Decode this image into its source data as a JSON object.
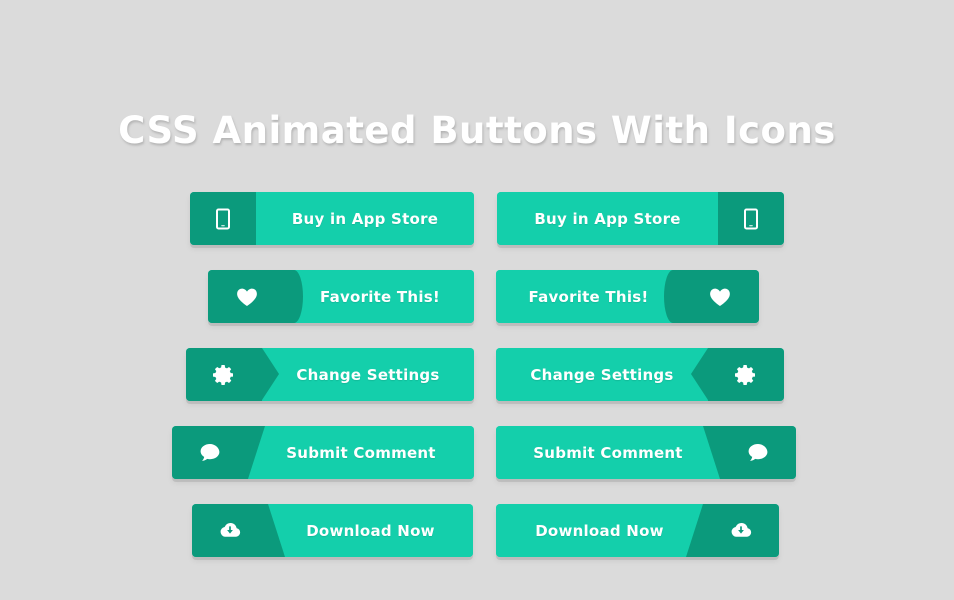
{
  "page": {
    "title": "CSS Animated Buttons With Icons",
    "background_color": "#dbdbdb"
  },
  "colors": {
    "icon_pane": "#0b9a7c",
    "label_pane": "#14cfab",
    "label_text": "#ffffff",
    "title_text": "#ffffff"
  },
  "buttons": [
    {
      "id": "buy-in-app-store-icon-left",
      "label": "Buy in App Store",
      "icon": "tablet-icon",
      "icon_side": "left",
      "divider": "straight"
    },
    {
      "id": "buy-in-app-store-icon-right",
      "label": "Buy in App Store",
      "icon": "tablet-icon",
      "icon_side": "right",
      "divider": "straight"
    },
    {
      "id": "favorite-this-icon-left",
      "label": "Favorite This!",
      "icon": "heart-icon",
      "icon_side": "left",
      "divider": "curve"
    },
    {
      "id": "favorite-this-icon-right",
      "label": "Favorite This!",
      "icon": "heart-icon",
      "icon_side": "right",
      "divider": "curve"
    },
    {
      "id": "change-settings-icon-left",
      "label": "Change Settings",
      "icon": "gear-icon",
      "icon_side": "left",
      "divider": "arrow"
    },
    {
      "id": "change-settings-icon-right",
      "label": "Change Settings",
      "icon": "gear-icon",
      "icon_side": "right",
      "divider": "arrow"
    },
    {
      "id": "submit-comment-icon-left",
      "label": "Submit Comment",
      "icon": "comment-icon",
      "icon_side": "left",
      "divider": "slant"
    },
    {
      "id": "submit-comment-icon-right",
      "label": "Submit Comment",
      "icon": "comment-icon",
      "icon_side": "right",
      "divider": "slant"
    },
    {
      "id": "download-now-icon-left",
      "label": "Download Now",
      "icon": "cloud-download-icon",
      "icon_side": "left",
      "divider": "slant-rev"
    },
    {
      "id": "download-now-icon-right",
      "label": "Download Now",
      "icon": "cloud-download-icon",
      "icon_side": "right",
      "divider": "slant-rev"
    }
  ]
}
